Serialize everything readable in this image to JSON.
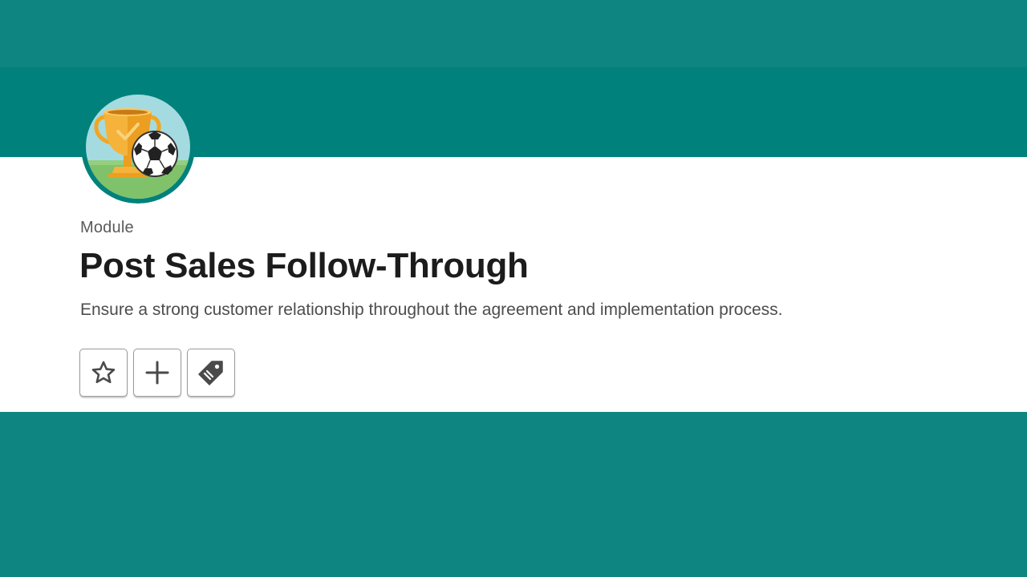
{
  "colors": {
    "brand_teal": "#00817b",
    "band_teal": "#0e8580",
    "card_bg": "#ffffff",
    "icon_gray": "#4a4a4a"
  },
  "badge": {
    "icon": "trophy-and-soccer-ball-icon"
  },
  "module": {
    "eyebrow": "Module",
    "title": "Post Sales Follow-Through",
    "description": "Ensure a strong customer relationship throughout the agreement and implementation process."
  },
  "actions": [
    {
      "icon": "star-icon"
    },
    {
      "icon": "plus-icon"
    },
    {
      "icon": "tag-icon"
    }
  ]
}
